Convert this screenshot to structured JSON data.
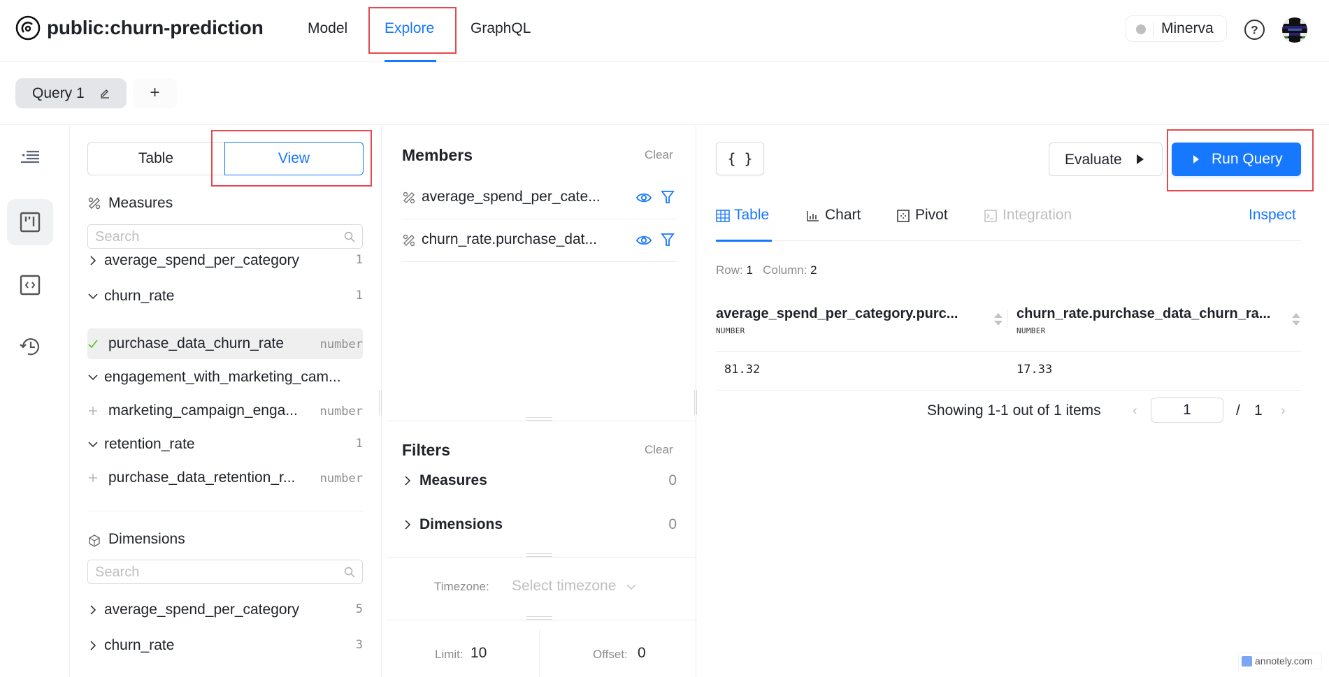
{
  "header": {
    "app_title": "public:churn-prediction",
    "nav": [
      {
        "label": "Model",
        "active": false
      },
      {
        "label": "Explore",
        "active": true
      },
      {
        "label": "GraphQL",
        "active": false
      }
    ],
    "workspace": {
      "name": "Minerva",
      "status": "offline"
    },
    "help_icon": "question-circle-icon",
    "avatar_icon": "user-avatar"
  },
  "query_tabs": {
    "tabs": [
      {
        "label": "Query 1",
        "active": true
      }
    ],
    "add_label": "+"
  },
  "rail": {
    "items": [
      {
        "name": "collapse-sidebar",
        "icon": "indent-icon"
      },
      {
        "name": "build",
        "icon": "build-icon",
        "active": true
      },
      {
        "name": "code",
        "icon": "code-icon"
      },
      {
        "name": "history",
        "icon": "history-icon"
      }
    ]
  },
  "schema": {
    "mode_toggle": {
      "options": [
        "Table",
        "View"
      ],
      "selected": "View"
    },
    "measures": {
      "title": "Measures",
      "search_placeholder": "Search",
      "groups": [
        {
          "name": "average_spend_per_category",
          "count": "1",
          "expanded": false,
          "items": []
        },
        {
          "name": "churn_rate",
          "count": "1",
          "expanded": true,
          "items": [
            {
              "name": "purchase_data_churn_rate",
              "type": "number",
              "selected": true
            }
          ]
        },
        {
          "name": "engagement_with_marketing_cam...",
          "count": "",
          "expanded": true,
          "items": [
            {
              "name": "marketing_campaign_enga...",
              "type": "number",
              "selected": false
            }
          ]
        },
        {
          "name": "retention_rate",
          "count": "1",
          "expanded": true,
          "items": [
            {
              "name": "purchase_data_retention_r...",
              "type": "number",
              "selected": false
            }
          ]
        }
      ]
    },
    "dimensions": {
      "title": "Dimensions",
      "search_placeholder": "Search",
      "groups": [
        {
          "name": "average_spend_per_category",
          "count": "5",
          "expanded": false
        },
        {
          "name": "churn_rate",
          "count": "3",
          "expanded": false
        }
      ]
    }
  },
  "members": {
    "title": "Members",
    "clear_label": "Clear",
    "items": [
      {
        "name": "average_spend_per_cate..."
      },
      {
        "name": "churn_rate.purchase_dat..."
      }
    ]
  },
  "filters": {
    "title": "Filters",
    "clear_label": "Clear",
    "groups": [
      {
        "name": "Measures",
        "count": "0"
      },
      {
        "name": "Dimensions",
        "count": "0"
      }
    ]
  },
  "timezone": {
    "label": "Timezone:",
    "placeholder": "Select timezone"
  },
  "limit": {
    "label": "Limit:",
    "value": "10"
  },
  "offset": {
    "label": "Offset:",
    "value": "0"
  },
  "results": {
    "json_button": "{ }",
    "evaluate_label": "Evaluate",
    "run_query_label": "Run Query",
    "tabs": [
      {
        "label": "Table",
        "active": true,
        "disabled": false
      },
      {
        "label": "Chart",
        "active": false,
        "disabled": false
      },
      {
        "label": "Pivot",
        "active": false,
        "disabled": false
      },
      {
        "label": "Integration",
        "active": false,
        "disabled": true
      }
    ],
    "inspect_label": "Inspect",
    "row_label": "Row:",
    "row_count": "1",
    "column_label": "Column:",
    "column_count": "2",
    "columns": [
      {
        "name": "average_spend_per_category.purc...",
        "type": "NUMBER"
      },
      {
        "name": "churn_rate.purchase_data_churn_ra...",
        "type": "NUMBER"
      }
    ],
    "rows": [
      [
        "81.32",
        "17.33"
      ]
    ],
    "pagination": {
      "summary": "Showing 1-1 out of 1 items",
      "current_page": "1",
      "separator": "/",
      "total_pages": "1"
    }
  },
  "watermark": "annotely.com",
  "colors": {
    "accent": "#1677ff",
    "annotation": "#e5484d",
    "selected_check": "#52c41a"
  }
}
